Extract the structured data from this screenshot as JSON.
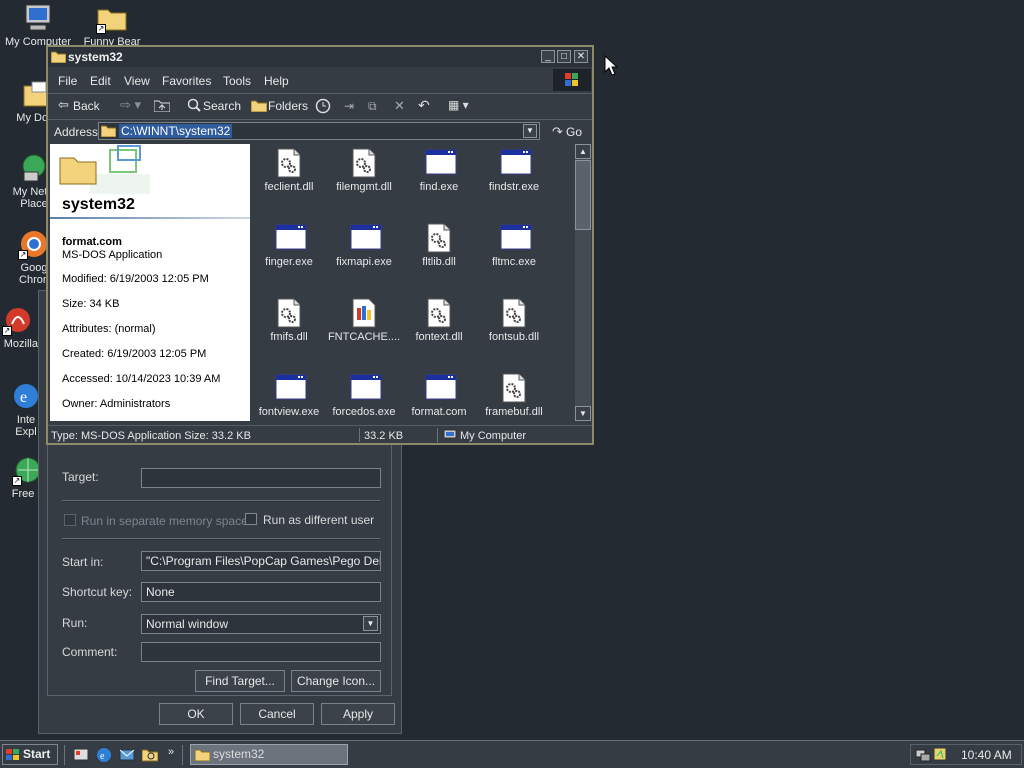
{
  "desktop": {
    "icons": [
      {
        "label": "My Computer"
      },
      {
        "label": "Funny Bear"
      },
      {
        "label": "My Docu"
      },
      {
        "label": "My Netw"
      },
      {
        "label": "Place"
      },
      {
        "label": "Goog"
      },
      {
        "label": "Chron"
      },
      {
        "label": "Mozilla"
      },
      {
        "label": "Inte"
      },
      {
        "label": "Expl"
      },
      {
        "label": "Free F"
      }
    ]
  },
  "properties_dialog": {
    "target_label": "Target:",
    "target_value": "",
    "run_separate_label": "Run in separate memory space",
    "run_as_label": "Run as different user",
    "start_in_label": "Start in:",
    "start_in_value": "\"C:\\Program Files\\PopCap Games\\Pego Deluxe\"",
    "shortcut_key_label": "Shortcut key:",
    "shortcut_key_value": "None",
    "run_label": "Run:",
    "run_value": "Normal window",
    "comment_label": "Comment:",
    "comment_value": "",
    "find_target_label": "Find Target...",
    "change_icon_label": "Change Icon...",
    "ok_label": "OK",
    "cancel_label": "Cancel",
    "apply_label": "Apply"
  },
  "explorer": {
    "title": "system32",
    "menu": [
      "File",
      "Edit",
      "View",
      "Favorites",
      "Tools",
      "Help"
    ],
    "toolbar": {
      "back": "Back",
      "search": "Search",
      "folders": "Folders"
    },
    "address_label": "Address",
    "address_value": "C:\\WINNT\\system32",
    "go_label": "Go",
    "folder_name": "system32",
    "details": {
      "name": "format.com",
      "type": "MS-DOS Application",
      "modified": "Modified: 6/19/2003 12:05 PM",
      "size": "Size: 34 KB",
      "attributes": "Attributes: (normal)",
      "created": "Created: 6/19/2003 12:05 PM",
      "accessed": "Accessed: 10/14/2023 10:39 AM",
      "owner": "Owner: Administrators"
    },
    "files": [
      {
        "name": "feclient.dll",
        "icon": "dll-gear-icon"
      },
      {
        "name": "filemgmt.dll",
        "icon": "dll-gear-icon"
      },
      {
        "name": "find.exe",
        "icon": "exe-window-icon"
      },
      {
        "name": "findstr.exe",
        "icon": "exe-window-icon"
      },
      {
        "name": "finger.exe",
        "icon": "exe-window-icon"
      },
      {
        "name": "fixmapi.exe",
        "icon": "exe-window-icon"
      },
      {
        "name": "fltlib.dll",
        "icon": "dll-gear-icon"
      },
      {
        "name": "fltmc.exe",
        "icon": "exe-window-icon"
      },
      {
        "name": "fmifs.dll",
        "icon": "dll-gear-icon"
      },
      {
        "name": "FNTCACHE....",
        "icon": "font-cache-icon"
      },
      {
        "name": "fontext.dll",
        "icon": "dll-gear-icon"
      },
      {
        "name": "fontsub.dll",
        "icon": "dll-gear-icon"
      },
      {
        "name": "fontview.exe",
        "icon": "exe-window-icon"
      },
      {
        "name": "forcedos.exe",
        "icon": "exe-window-icon"
      },
      {
        "name": "format.com",
        "icon": "exe-window-icon"
      },
      {
        "name": "framebuf.dll",
        "icon": "dll-gear-icon"
      }
    ],
    "status": {
      "type_size": "Type: MS-DOS Application Size: 33.2 KB",
      "size": "33.2 KB",
      "zone": "My Computer"
    }
  },
  "taskbar": {
    "start_label": "Start",
    "active_task": "system32",
    "clock": "10:40 AM"
  }
}
